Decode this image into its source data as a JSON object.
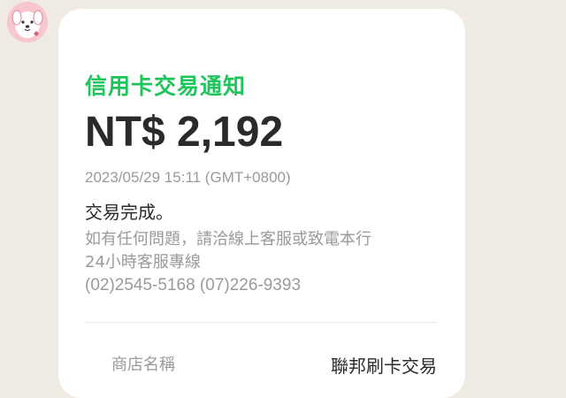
{
  "avatar": {
    "icon": "dog-mascot-icon"
  },
  "notification": {
    "title": "信用卡交易通知",
    "amount": "NT$ 2,192",
    "timestamp": "2023/05/29 15:11 (GMT+0800)",
    "status": "交易完成。",
    "help_line1": "如有任何問題，請洽線上客服或致電本行",
    "help_line2": "24小時客服專線",
    "help_phones": "(02)2545-5168 (07)226-9393",
    "store_label": "商店名稱",
    "store_value": "聯邦刷卡交易"
  },
  "colors": {
    "title_green": "#1ec55a",
    "chat_background": "#efeae2",
    "avatar_pink": "#f7c6cf"
  }
}
